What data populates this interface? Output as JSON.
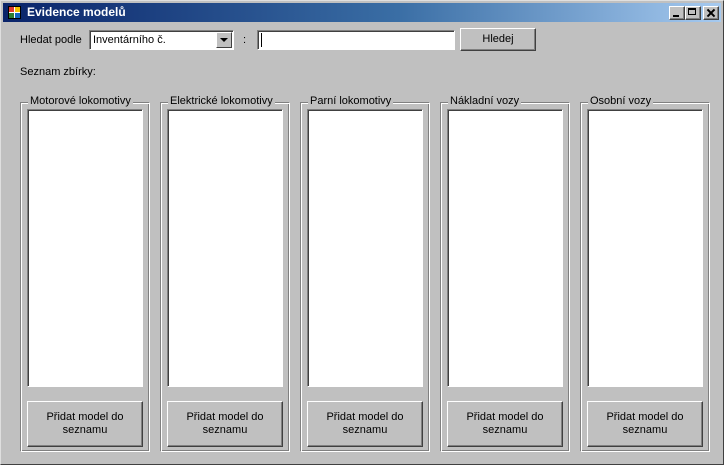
{
  "window": {
    "title": "Evidence modelů"
  },
  "search": {
    "label": "Hledat podle",
    "field_selected": "Inventárního č.",
    "separator": ":",
    "value": "",
    "button_label": "Hledej"
  },
  "collection_label": "Seznam zbírky:",
  "categories": [
    {
      "title": "Motorové lokomotivy",
      "button_label": "Přidat model do seznamu"
    },
    {
      "title": "Elektrické lokomotivy",
      "button_label": "Přidat model do seznamu"
    },
    {
      "title": "Parní lokomotivy",
      "button_label": "Přidat model do seznamu"
    },
    {
      "title": "Nákladní vozy",
      "button_label": "Přidat model do seznamu"
    },
    {
      "title": "Osobní vozy",
      "button_label": "Přidat model do seznamu"
    }
  ]
}
